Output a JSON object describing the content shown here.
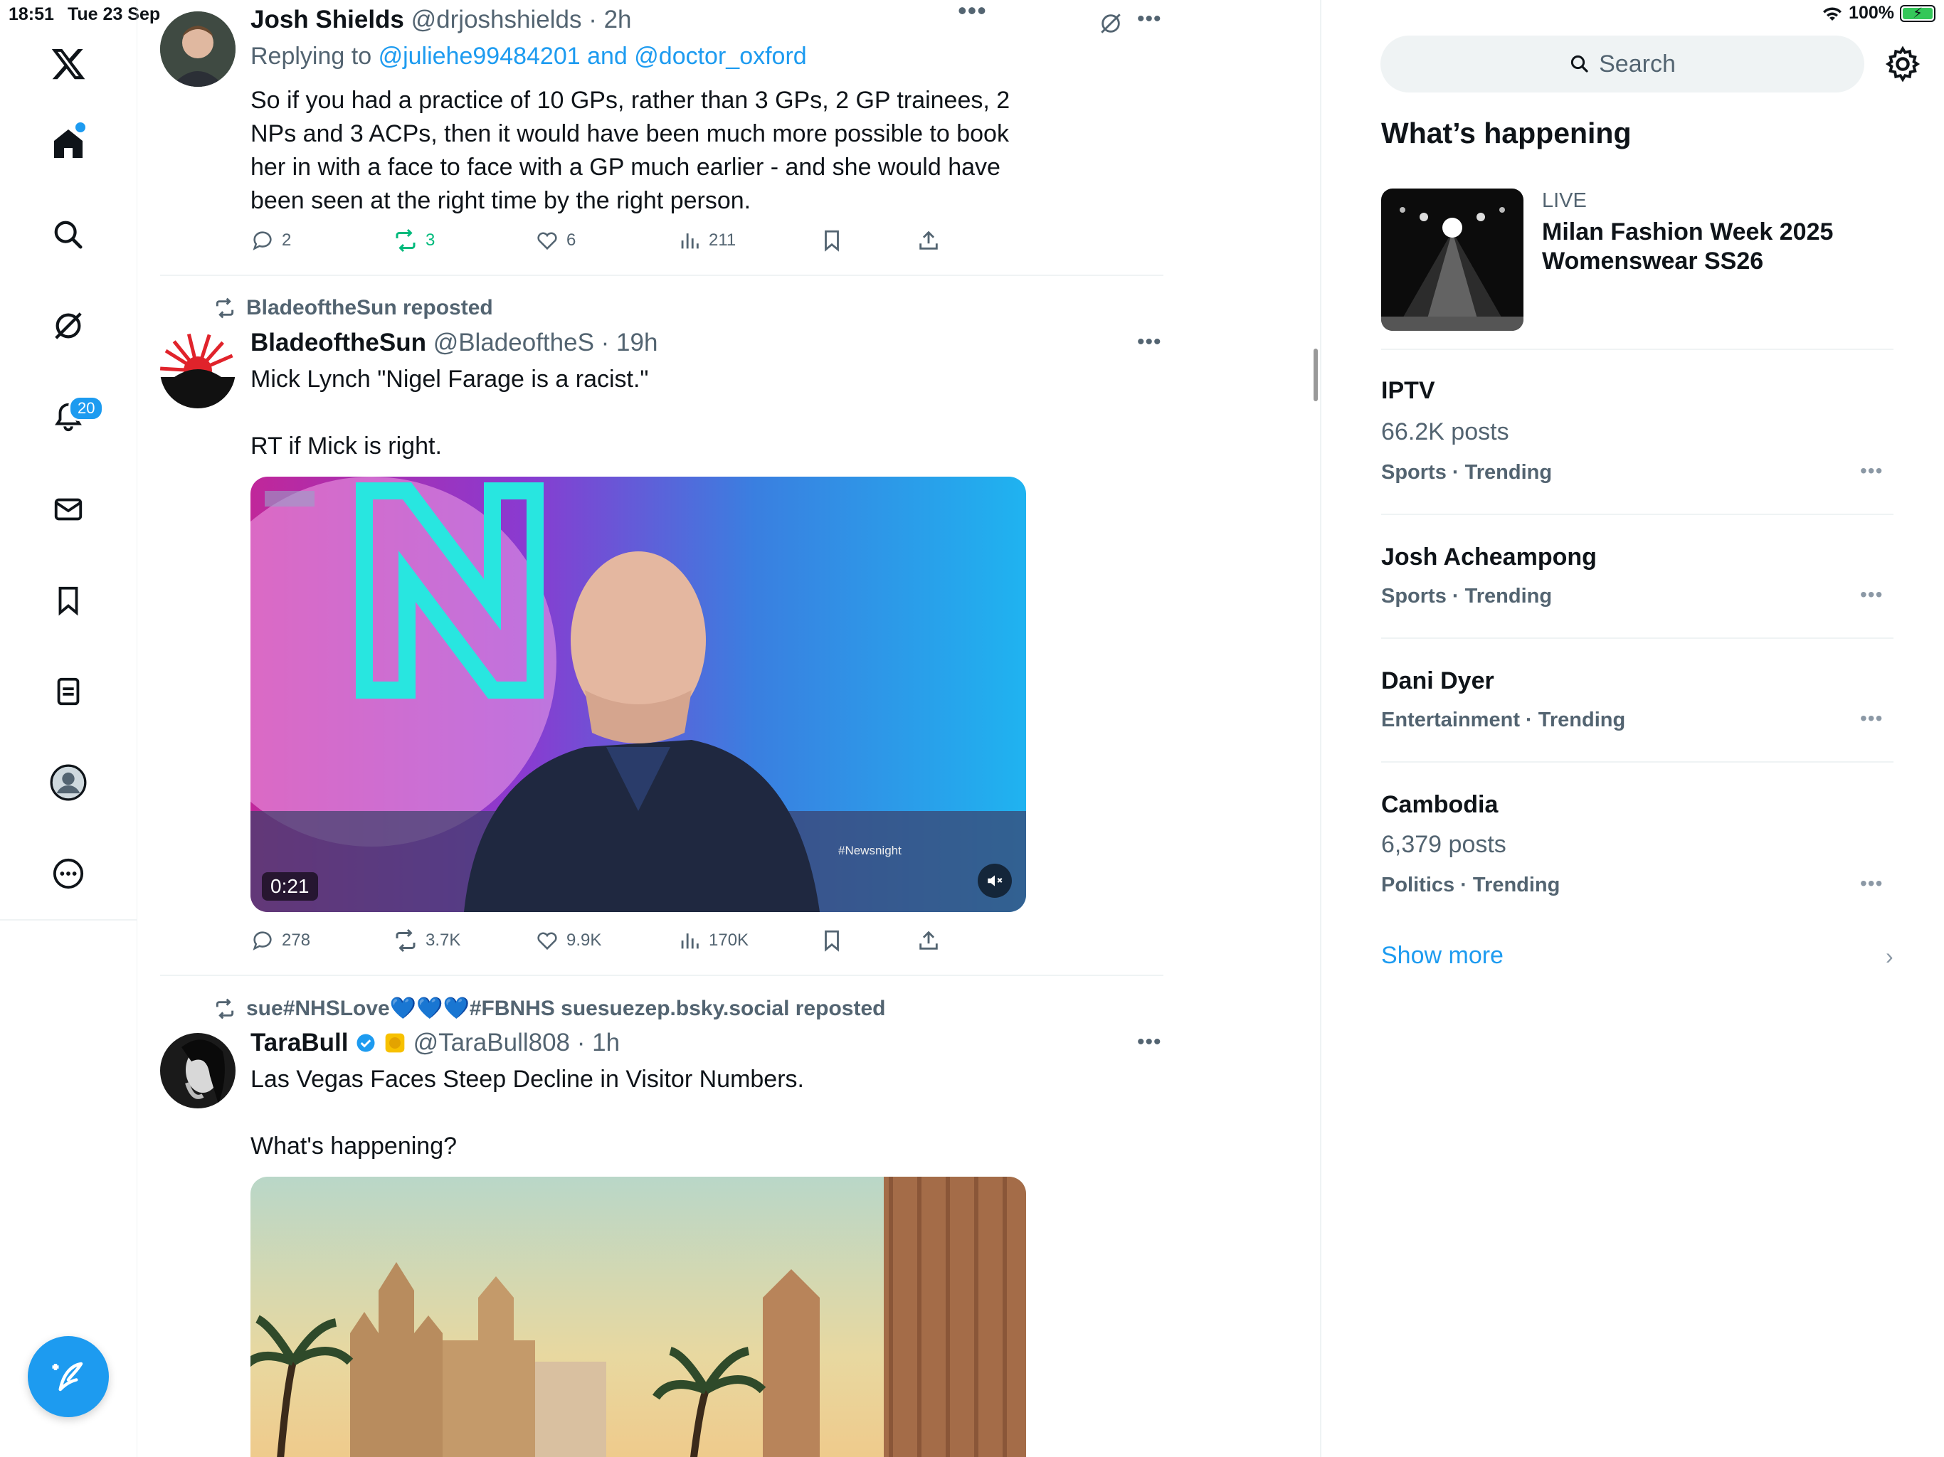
{
  "status_bar": {
    "time": "18:51",
    "date": "Tue 23 Sep",
    "battery": "100%"
  },
  "nav": {
    "notifications_badge": "20"
  },
  "tweets": [
    {
      "author": "Josh Shields",
      "handle": "@drjoshshields",
      "time": "· 2h",
      "replying_prefix": "Replying to",
      "replying_to": "@juliehe99484201 and @doctor_oxford",
      "text": "So if you had a practice of 10 GPs, rather than 3 GPs, 2 GP trainees, 2 NPs and 3 ACPs, then it would have been much more possible to book her in with a face to face with a GP much earlier - and she would have been seen at the right time by the right person.",
      "replies": "2",
      "reposts": "3",
      "likes": "6",
      "views": "211"
    },
    {
      "reposted_by": "BladeoftheSun reposted",
      "author": "BladeoftheSun",
      "handle": "@BladeoftheS",
      "time": "· 19h",
      "text": "Mick Lynch \"Nigel Farage is a racist.\"\n\nRT if Mick is right.",
      "video_duration": "0:21",
      "video_watermark": "#Newsnight",
      "replies": "278",
      "reposts": "3.7K",
      "likes": "9.9K",
      "views": "170K"
    },
    {
      "reposted_by": "sue#NHSLove💙💙💙#FBNHS suesuezep.bsky.social reposted",
      "author": "TaraBull",
      "handle": "@TaraBull808",
      "time": "· 1h",
      "text": "Las Vegas Faces Steep Decline in Visitor Numbers.\n\nWhat's happening?"
    }
  ],
  "sidebar": {
    "search_label": "Search",
    "whats_happening": "What’s happening",
    "live": {
      "label": "LIVE",
      "title": "Milan Fashion Week 2025 Womenswear SS26"
    },
    "trends": [
      {
        "name": "IPTV",
        "count": "66.2K posts",
        "meta": "Sports · Trending"
      },
      {
        "name": "Josh Acheampong",
        "count": "",
        "meta": "Sports · Trending"
      },
      {
        "name": "Dani Dyer",
        "count": "",
        "meta": "Entertainment · Trending"
      },
      {
        "name": "Cambodia",
        "count": "6,379 posts",
        "meta": "Politics · Trending"
      }
    ],
    "show_more": "Show more"
  },
  "colors": {
    "accent": "#1d9bf0",
    "repost_green": "#00ba7c",
    "muted": "#536471"
  },
  "icons": [
    "x-logo-icon",
    "home-icon",
    "search-icon",
    "grok-icon",
    "bell-icon",
    "mail-icon",
    "bookmark-icon",
    "lists-icon",
    "profile-icon",
    "more-icon",
    "compose-icon",
    "gear-icon"
  ]
}
